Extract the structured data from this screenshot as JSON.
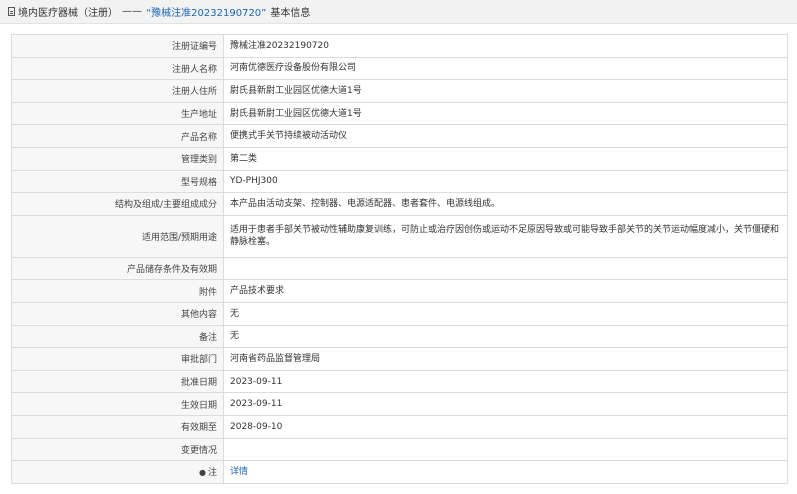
{
  "header": {
    "prefix": "境内医疗器械（注册）",
    "separator": "——",
    "highlight": "“豫械注准20232190720”",
    "suffix": "基本信息"
  },
  "rows": [
    {
      "label": "注册证编号",
      "value": "豫械注准20232190720"
    },
    {
      "label": "注册人名称",
      "value": "河南优德医疗设备股份有限公司"
    },
    {
      "label": "注册人住所",
      "value": "尉氏县新尉工业园区优德大道1号"
    },
    {
      "label": "生产地址",
      "value": "尉氏县新尉工业园区优德大道1号"
    },
    {
      "label": "产品名称",
      "value": "便携式手关节持续被动活动仪"
    },
    {
      "label": "管理类别",
      "value": "第二类"
    },
    {
      "label": "型号规格",
      "value": "YD-PHJ300"
    },
    {
      "label": "结构及组成/主要组成成分",
      "value": "本产品由活动支架、控制器、电源适配器、患者套件、电源线组成。"
    },
    {
      "label": "适用范围/预期用途",
      "value": "适用于患者手部关节被动性辅助康复训练，可防止或治疗因创伤或运动不足原因导致或可能导致手部关节的关节运动幅度减小，关节僵硬和静脉栓塞。"
    },
    {
      "label": "产品储存条件及有效期",
      "value": ""
    },
    {
      "label": "附件",
      "value": "产品技术要求"
    },
    {
      "label": "其他内容",
      "value": "无"
    },
    {
      "label": "备注",
      "value": "无"
    },
    {
      "label": "审批部门",
      "value": "河南省药品监督管理局"
    },
    {
      "label": "批准日期",
      "value": "2023-09-11"
    },
    {
      "label": "生效日期",
      "value": "2023-09-11"
    },
    {
      "label": "有效期至",
      "value": "2028-09-10"
    },
    {
      "label": "变更情况",
      "value": ""
    }
  ],
  "note_row": {
    "label": "注",
    "icon": "pin-icon",
    "link_text": "详情"
  },
  "colors": {
    "link": "#1a66b3",
    "label_bg": "#f7f7f7",
    "border": "#dcdcdc"
  }
}
